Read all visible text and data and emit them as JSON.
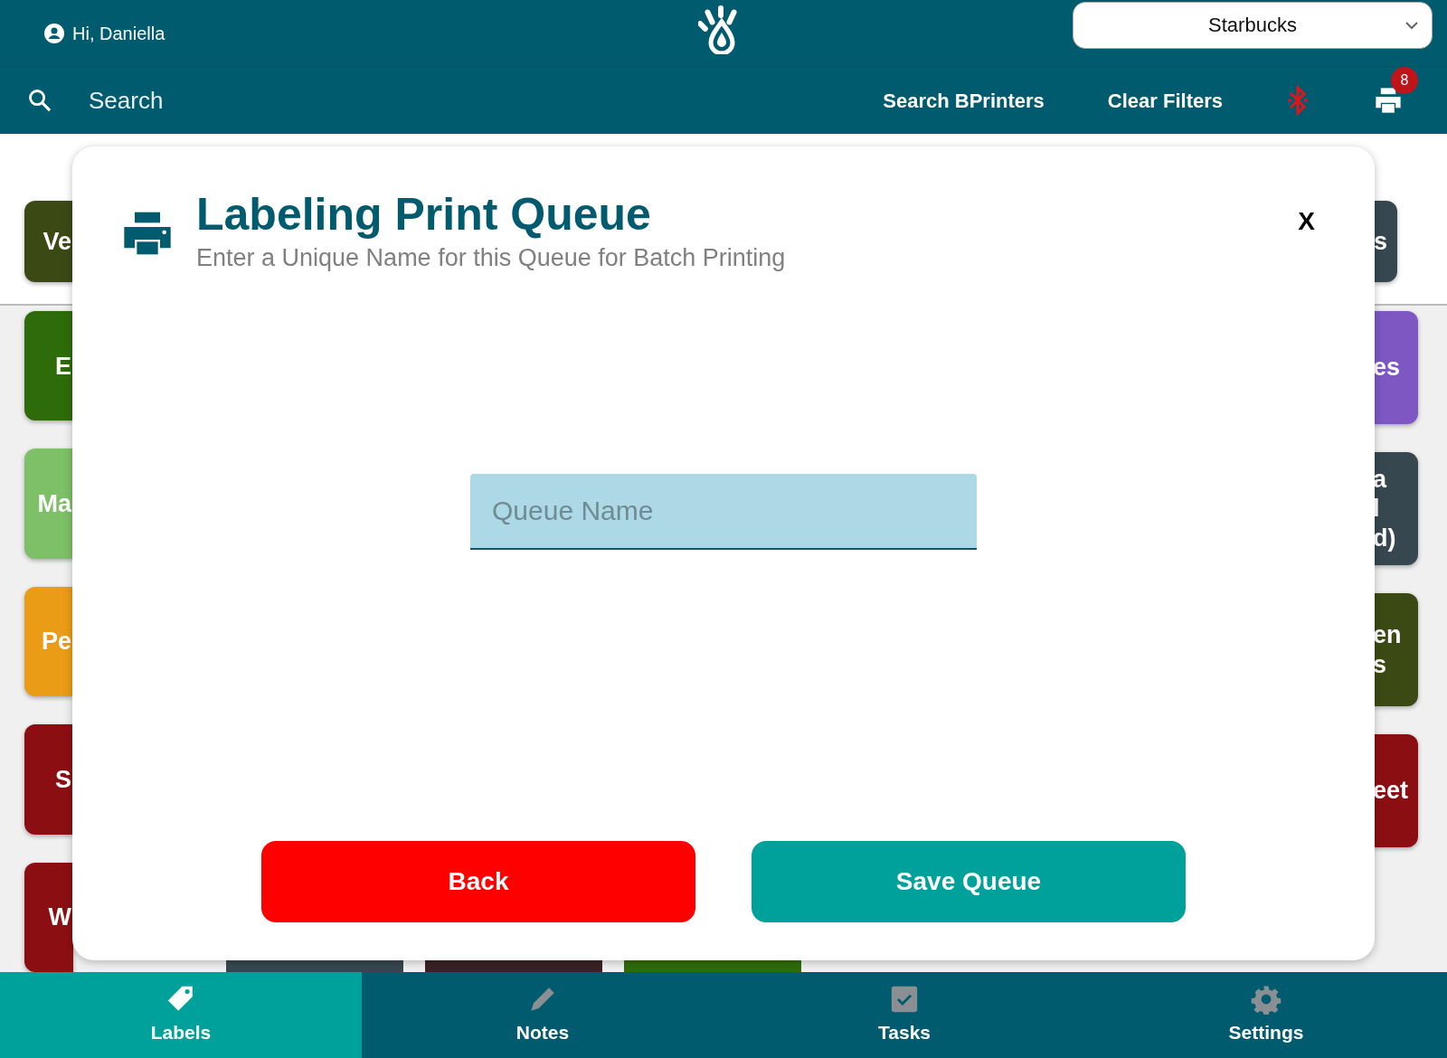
{
  "header": {
    "greeting": "Hi, Daniella",
    "store_select": {
      "value": "Starbucks"
    }
  },
  "toolbar": {
    "search": {
      "placeholder": "Search"
    },
    "buttons": [
      "Search BPrinters",
      "Clear Filters"
    ],
    "bluetooth_connected": false,
    "printer_badge": "8"
  },
  "background_tiles": {
    "left": [
      {
        "lines": [
          "Ve"
        ],
        "color": "#3b4a14"
      },
      {
        "lines": [
          "E"
        ],
        "color": "#2e6b0a"
      },
      {
        "lines": [
          "Ma"
        ],
        "color": "#7dc067"
      },
      {
        "lines": [
          "Pe"
        ],
        "color": "#eb9c16"
      },
      {
        "lines": [
          "S"
        ],
        "color": "#8b0f12"
      },
      {
        "lines": [
          "W"
        ],
        "color": "#8b0f12"
      }
    ],
    "right": [
      {
        "lines": [
          "s"
        ],
        "color": "#37474f"
      },
      {
        "lines": [
          "es"
        ],
        "color": "#7e57c2"
      },
      {
        "lines": [
          "a",
          "l",
          "d)"
        ],
        "color": "#37474f"
      },
      {
        "lines": [
          "en",
          "s"
        ],
        "color": "#3b4a14"
      },
      {
        "lines": [
          "eet"
        ],
        "color": "#8b0f12"
      }
    ],
    "bottom": [
      {
        "color": "#37474f"
      },
      {
        "color": "#3a2226"
      },
      {
        "color": "#2e6b0a"
      }
    ]
  },
  "dialog": {
    "title": "Labeling Print Queue",
    "subtitle": "Enter a Unique Name for this Queue for Batch Printing",
    "close": "X",
    "queue_name": {
      "placeholder": "Queue Name"
    },
    "buttons": [
      {
        "kind": "back",
        "label": "Back"
      },
      {
        "kind": "save",
        "label": "Save Queue"
      }
    ]
  },
  "bottom_nav": [
    {
      "kind": "tag",
      "label": "Labels",
      "selected": true
    },
    {
      "kind": "pencil",
      "label": "Notes",
      "selected": false
    },
    {
      "kind": "check",
      "label": "Tasks",
      "selected": false
    },
    {
      "kind": "gear",
      "label": "Settings",
      "selected": false
    }
  ]
}
